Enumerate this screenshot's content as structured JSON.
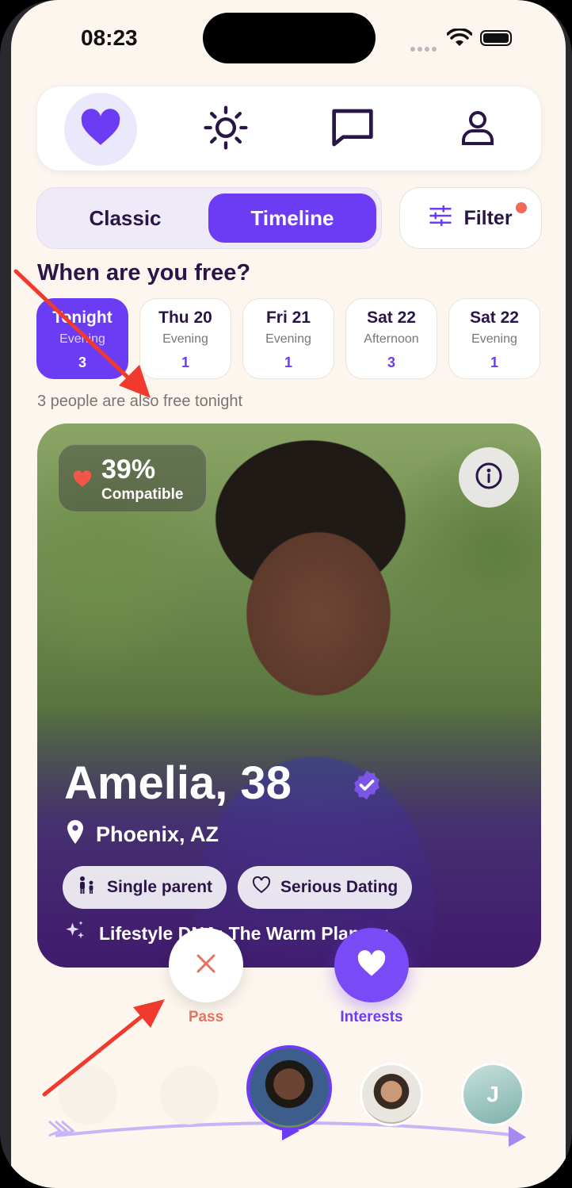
{
  "status": {
    "time": "08:23"
  },
  "nav": {
    "items": [
      "heart-icon",
      "sun-icon",
      "chat-icon",
      "profile-icon"
    ],
    "active": "heart-icon"
  },
  "mode": {
    "classic": "Classic",
    "timeline": "Timeline",
    "active": "Timeline"
  },
  "filter": {
    "label": "Filter"
  },
  "schedule": {
    "heading": "When are you free?",
    "days": [
      {
        "title": "Tonight",
        "period": "Evening",
        "count": "3"
      },
      {
        "title": "Thu 20",
        "period": "Evening",
        "count": "1"
      },
      {
        "title": "Fri 21",
        "period": "Evening",
        "count": "1"
      },
      {
        "title": "Sat 22",
        "period": "Afternoon",
        "count": "3"
      },
      {
        "title": "Sat 22",
        "period": "Evening",
        "count": "1"
      }
    ],
    "note": "3 people are also free tonight"
  },
  "profile": {
    "compatibility": "39%",
    "compatibility_label": "Compatible",
    "name": "Amelia, 38",
    "location": "Phoenix, AZ",
    "tags": [
      "Single parent",
      "Serious Dating"
    ],
    "lifestyle": "Lifestyle DNA: The Warm Planner"
  },
  "actions": {
    "pass": "Pass",
    "interests": "Interests"
  },
  "timeline": {
    "initial": "J"
  },
  "colors": {
    "accent": "#6b3cf4",
    "pass": "#e8725f",
    "annotation": "#f03a2e",
    "background": "#fdf6ee"
  }
}
